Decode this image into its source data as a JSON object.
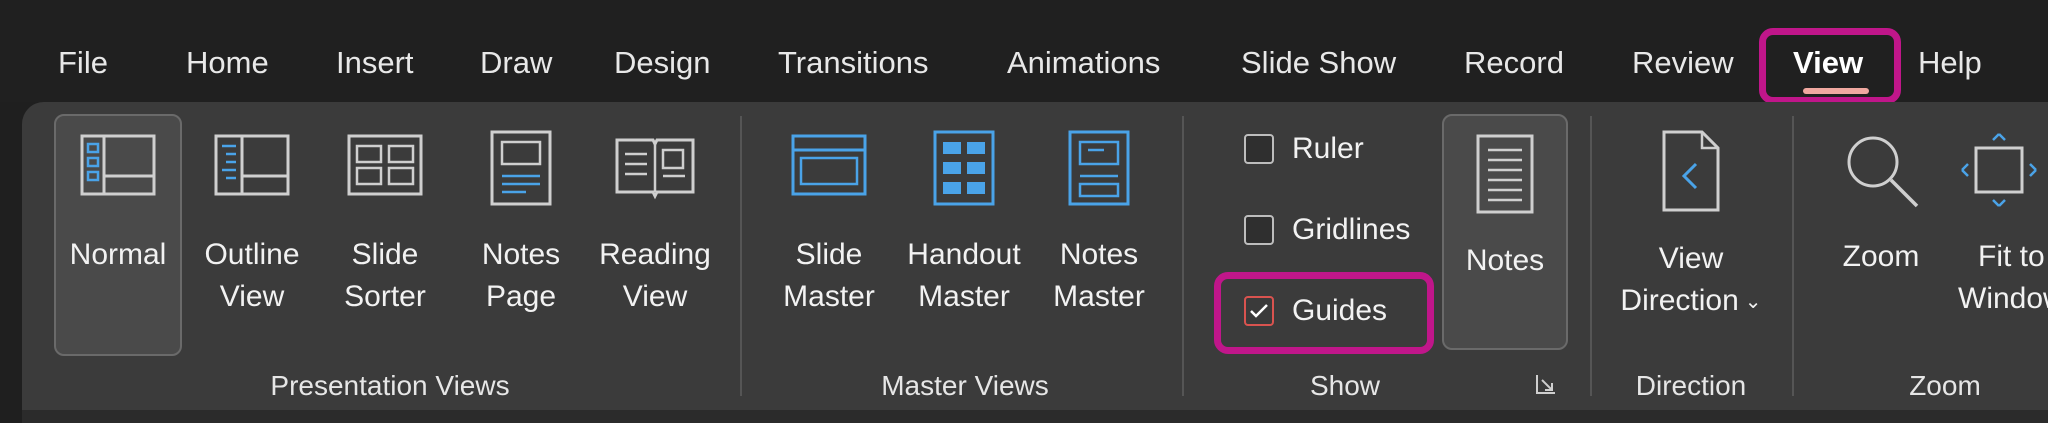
{
  "menu": {
    "tabs": [
      {
        "id": "file",
        "label": "File"
      },
      {
        "id": "home",
        "label": "Home"
      },
      {
        "id": "insert",
        "label": "Insert"
      },
      {
        "id": "draw",
        "label": "Draw"
      },
      {
        "id": "design",
        "label": "Design"
      },
      {
        "id": "transitions",
        "label": "Transitions"
      },
      {
        "id": "animations",
        "label": "Animations"
      },
      {
        "id": "slideshow",
        "label": "Slide Show"
      },
      {
        "id": "record",
        "label": "Record"
      },
      {
        "id": "review",
        "label": "Review"
      },
      {
        "id": "view",
        "label": "View"
      },
      {
        "id": "help",
        "label": "Help"
      }
    ],
    "active_tab": "View"
  },
  "ribbon": {
    "presentation_views": {
      "label": "Presentation Views",
      "buttons": [
        {
          "line1": "Normal",
          "line2": "",
          "icon": "normal-view-icon",
          "selected": true
        },
        {
          "line1": "Outline",
          "line2": "View",
          "icon": "outline-view-icon"
        },
        {
          "line1": "Slide",
          "line2": "Sorter",
          "icon": "slide-sorter-icon"
        },
        {
          "line1": "Notes",
          "line2": "Page",
          "icon": "notes-page-icon"
        },
        {
          "line1": "Reading",
          "line2": "View",
          "icon": "reading-view-icon"
        }
      ]
    },
    "master_views": {
      "label": "Master Views",
      "buttons": [
        {
          "line1": "Slide",
          "line2": "Master",
          "icon": "slide-master-icon"
        },
        {
          "line1": "Handout",
          "line2": "Master",
          "icon": "handout-master-icon"
        },
        {
          "line1": "Notes",
          "line2": "Master",
          "icon": "notes-master-icon"
        }
      ]
    },
    "show": {
      "label": "Show",
      "checkboxes": [
        {
          "label": "Ruler",
          "checked": false
        },
        {
          "label": "Gridlines",
          "checked": false
        },
        {
          "label": "Guides",
          "checked": true
        }
      ],
      "notes_button": {
        "label": "Notes",
        "icon": "notes-icon",
        "selected": true
      }
    },
    "direction": {
      "label": "Direction",
      "button": {
        "line1": "View",
        "line2": "Direction",
        "icon": "view-direction-icon"
      }
    },
    "zoom": {
      "label": "Zoom",
      "buttons": [
        {
          "line1": "Zoom",
          "line2": "",
          "icon": "magnifier-icon"
        },
        {
          "line1": "Fit to",
          "line2": "Window",
          "icon": "fit-to-window-icon"
        }
      ]
    }
  },
  "colors": {
    "accent_blue": "#4aa3e8",
    "highlight_magenta": "#c0168a",
    "check_red": "#d9534f",
    "ribbon_bg": "#3b3b3b",
    "menubar_bg": "#202020"
  }
}
